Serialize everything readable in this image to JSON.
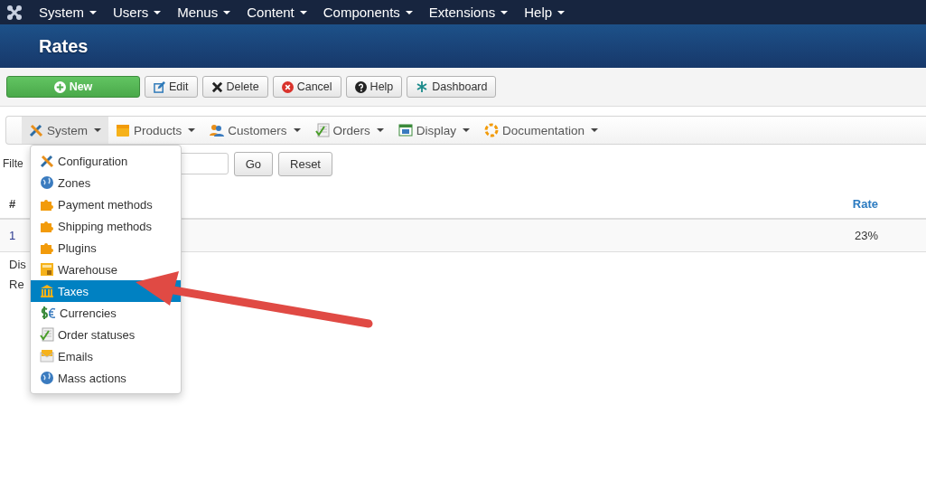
{
  "top_menu": [
    {
      "label": "System"
    },
    {
      "label": "Users"
    },
    {
      "label": "Menus"
    },
    {
      "label": "Content"
    },
    {
      "label": "Components"
    },
    {
      "label": "Extensions"
    },
    {
      "label": "Help"
    }
  ],
  "page_title": "Rates",
  "toolbar": [
    {
      "label": "New",
      "kind": "new"
    },
    {
      "label": "Edit",
      "kind": "edit"
    },
    {
      "label": "Delete",
      "kind": "delete"
    },
    {
      "label": "Cancel",
      "kind": "cancel"
    },
    {
      "label": "Help",
      "kind": "help"
    },
    {
      "label": "Dashboard",
      "kind": "dashboard"
    }
  ],
  "component_menu": [
    {
      "label": "System",
      "kind": "tools",
      "selected": true
    },
    {
      "label": "Products",
      "kind": "box",
      "selected": false
    },
    {
      "label": "Customers",
      "kind": "people",
      "selected": false
    },
    {
      "label": "Orders",
      "kind": "check",
      "selected": false
    },
    {
      "label": "Display",
      "kind": "window",
      "selected": false
    },
    {
      "label": "Documentation",
      "kind": "lifebuoy",
      "selected": false
    }
  ],
  "dropdown": {
    "items": [
      {
        "label": "Configuration",
        "kind": "tools",
        "selected": false
      },
      {
        "label": "Zones",
        "kind": "globe",
        "selected": false
      },
      {
        "label": "Payment methods",
        "kind": "puzzle",
        "selected": false
      },
      {
        "label": "Shipping methods",
        "kind": "puzzle",
        "selected": false
      },
      {
        "label": "Plugins",
        "kind": "puzzle",
        "selected": false
      },
      {
        "label": "Warehouse",
        "kind": "warehouse",
        "selected": false
      },
      {
        "label": "Taxes",
        "kind": "bank",
        "selected": true
      },
      {
        "label": "Currencies",
        "kind": "money",
        "selected": false
      },
      {
        "label": "Order statuses",
        "kind": "check",
        "selected": false
      },
      {
        "label": "Emails",
        "kind": "mail",
        "selected": false
      },
      {
        "label": "Mass actions",
        "kind": "globe",
        "selected": false
      }
    ]
  },
  "filter": {
    "label": "Filte",
    "buttons": [
      "Go",
      "Reset"
    ]
  },
  "table": {
    "columns": [
      {
        "label": "#"
      },
      {
        "label": "Rate"
      }
    ],
    "rows": [
      {
        "cells": [
          "1",
          "23%"
        ]
      }
    ]
  },
  "footer_texts": [
    "Dis",
    "Re"
  ]
}
